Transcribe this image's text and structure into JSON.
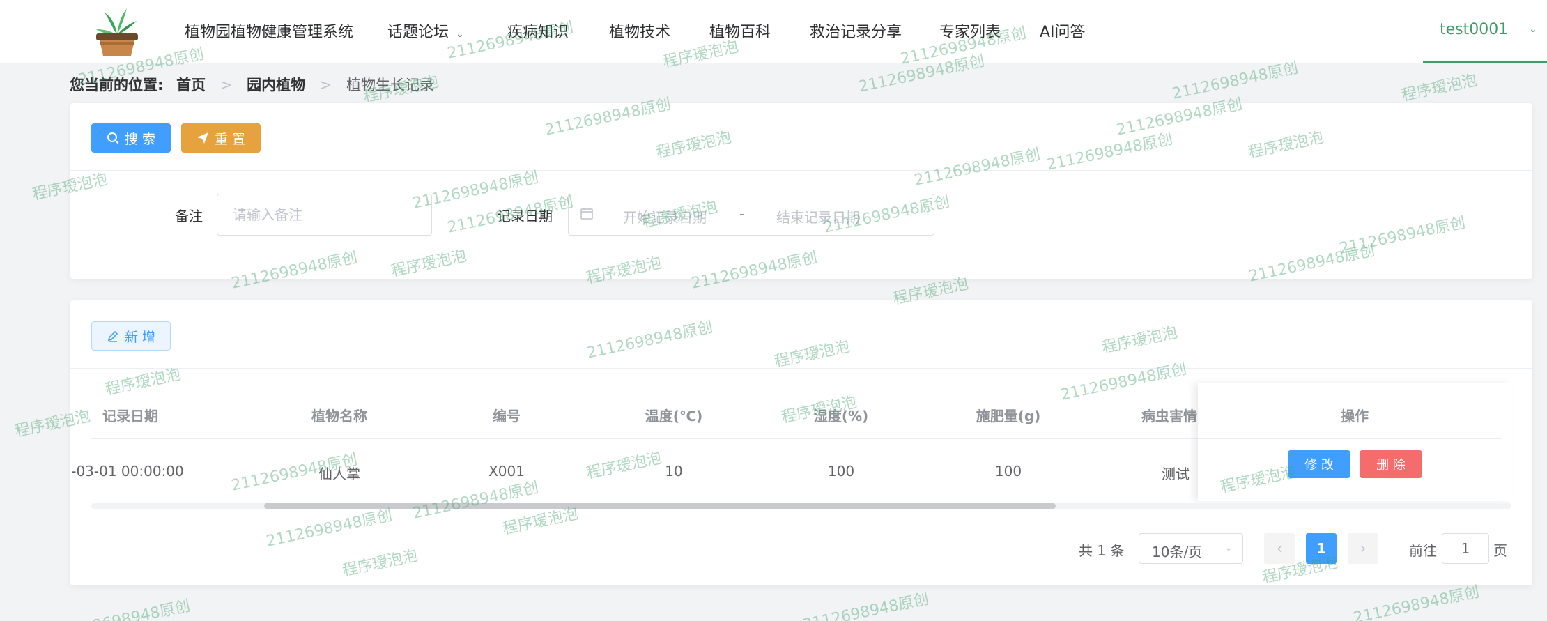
{
  "nav": {
    "brand": "植物园植物健康管理系统",
    "items": [
      {
        "label": "话题论坛",
        "has_dropdown": true
      },
      {
        "label": "疾病知识"
      },
      {
        "label": "植物技术"
      },
      {
        "label": "植物百科"
      },
      {
        "label": "救治记录分享"
      },
      {
        "label": "专家列表"
      },
      {
        "label": "AI问答"
      }
    ],
    "user": "test0001"
  },
  "breadcrumb": {
    "prefix": "您当前的位置:",
    "items": [
      "首页",
      "园内植物",
      "植物生长记录"
    ]
  },
  "search": {
    "search_label": "搜 索",
    "reset_label": "重 置",
    "remark_label": "备注",
    "remark_placeholder": "请输入备注",
    "date_label": "记录日期",
    "date_start_placeholder": "开始记录日期",
    "date_separator": "-",
    "date_end_placeholder": "结束记录日期"
  },
  "toolbar": {
    "add_label": "新 增"
  },
  "table": {
    "columns": [
      "记录日期",
      "植物名称",
      "编号",
      "温度(℃)",
      "湿度(%)",
      "施肥量(g)",
      "病虫害情",
      "操作"
    ],
    "rows": [
      {
        "date": "-03-01 00:00:00",
        "name": "仙人掌",
        "code": "X001",
        "temp": "10",
        "humidity": "100",
        "fertilizer": "100",
        "pest": "测试"
      }
    ],
    "edit_label": "修 改",
    "delete_label": "删 除"
  },
  "pagination": {
    "total_text": "共 1 条",
    "page_size": "10条/页",
    "current_page": "1",
    "goto_prefix": "前往",
    "goto_value": "1",
    "goto_suffix": "页"
  },
  "colors": {
    "primary": "#409eff",
    "warning": "#e6a23c",
    "danger": "#f56c6c",
    "brand_green": "#3b9e69"
  },
  "watermark": {
    "texts": [
      "2112698948原创",
      "程序瑷泡泡"
    ]
  }
}
